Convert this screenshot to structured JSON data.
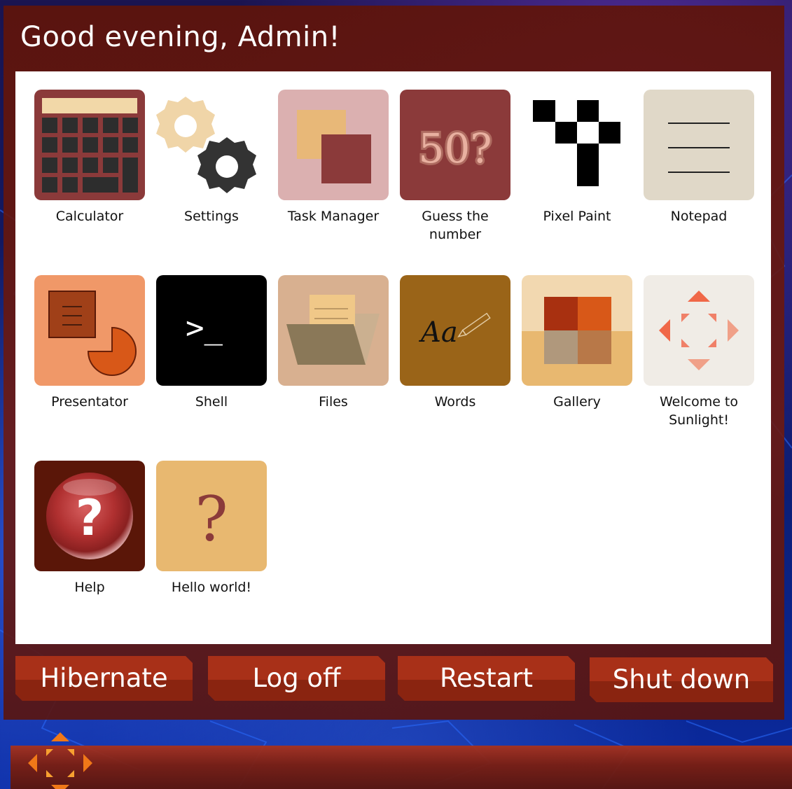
{
  "greeting": "Good evening, Admin!",
  "apps": [
    {
      "label": "Calculator",
      "icon": "calculator-icon"
    },
    {
      "label": "Settings",
      "icon": "gears-icon"
    },
    {
      "label": "Task Manager",
      "icon": "windows-icon"
    },
    {
      "label": "Guess the number",
      "icon": "guess-number-icon",
      "icon_text": "50?"
    },
    {
      "label": "Pixel Paint",
      "icon": "pixel-icon"
    },
    {
      "label": "Notepad",
      "icon": "notepad-icon"
    },
    {
      "label": "Presentator",
      "icon": "presentation-icon"
    },
    {
      "label": "Shell",
      "icon": "terminal-icon",
      "icon_text": ">_"
    },
    {
      "label": "Files",
      "icon": "folder-icon"
    },
    {
      "label": "Words",
      "icon": "words-icon",
      "icon_text": "Aa"
    },
    {
      "label": "Gallery",
      "icon": "gallery-icon"
    },
    {
      "label": "Welcome to Sunlight!",
      "icon": "sunlight-logo-icon"
    },
    {
      "label": "Help",
      "icon": "help-icon",
      "icon_text": "?"
    },
    {
      "label": "Hello world!",
      "icon": "question-icon",
      "icon_text": "?"
    }
  ],
  "power": {
    "hibernate": "Hibernate",
    "log_off": "Log off",
    "restart": "Restart",
    "shut_down": "Shut down"
  },
  "colors": {
    "accent": "#a83018",
    "menu_background": "#6a1a10",
    "panel": "#ffffff",
    "start_button": "#f07818"
  }
}
